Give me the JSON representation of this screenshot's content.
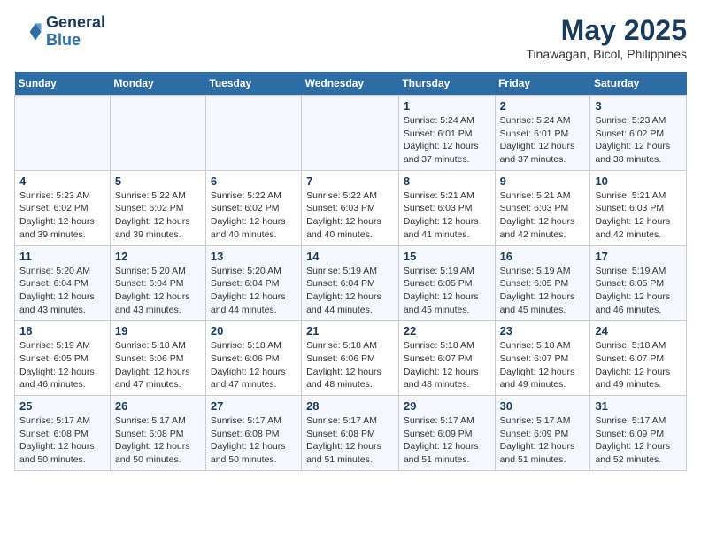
{
  "header": {
    "logo_line1": "General",
    "logo_line2": "Blue",
    "month": "May 2025",
    "location": "Tinawagan, Bicol, Philippines"
  },
  "days_of_week": [
    "Sunday",
    "Monday",
    "Tuesday",
    "Wednesday",
    "Thursday",
    "Friday",
    "Saturday"
  ],
  "weeks": [
    [
      {
        "day": "",
        "info": ""
      },
      {
        "day": "",
        "info": ""
      },
      {
        "day": "",
        "info": ""
      },
      {
        "day": "",
        "info": ""
      },
      {
        "day": "1",
        "info": "Sunrise: 5:24 AM\nSunset: 6:01 PM\nDaylight: 12 hours and 37 minutes."
      },
      {
        "day": "2",
        "info": "Sunrise: 5:24 AM\nSunset: 6:01 PM\nDaylight: 12 hours and 37 minutes."
      },
      {
        "day": "3",
        "info": "Sunrise: 5:23 AM\nSunset: 6:02 PM\nDaylight: 12 hours and 38 minutes."
      }
    ],
    [
      {
        "day": "4",
        "info": "Sunrise: 5:23 AM\nSunset: 6:02 PM\nDaylight: 12 hours and 39 minutes."
      },
      {
        "day": "5",
        "info": "Sunrise: 5:22 AM\nSunset: 6:02 PM\nDaylight: 12 hours and 39 minutes."
      },
      {
        "day": "6",
        "info": "Sunrise: 5:22 AM\nSunset: 6:02 PM\nDaylight: 12 hours and 40 minutes."
      },
      {
        "day": "7",
        "info": "Sunrise: 5:22 AM\nSunset: 6:03 PM\nDaylight: 12 hours and 40 minutes."
      },
      {
        "day": "8",
        "info": "Sunrise: 5:21 AM\nSunset: 6:03 PM\nDaylight: 12 hours and 41 minutes."
      },
      {
        "day": "9",
        "info": "Sunrise: 5:21 AM\nSunset: 6:03 PM\nDaylight: 12 hours and 42 minutes."
      },
      {
        "day": "10",
        "info": "Sunrise: 5:21 AM\nSunset: 6:03 PM\nDaylight: 12 hours and 42 minutes."
      }
    ],
    [
      {
        "day": "11",
        "info": "Sunrise: 5:20 AM\nSunset: 6:04 PM\nDaylight: 12 hours and 43 minutes."
      },
      {
        "day": "12",
        "info": "Sunrise: 5:20 AM\nSunset: 6:04 PM\nDaylight: 12 hours and 43 minutes."
      },
      {
        "day": "13",
        "info": "Sunrise: 5:20 AM\nSunset: 6:04 PM\nDaylight: 12 hours and 44 minutes."
      },
      {
        "day": "14",
        "info": "Sunrise: 5:19 AM\nSunset: 6:04 PM\nDaylight: 12 hours and 44 minutes."
      },
      {
        "day": "15",
        "info": "Sunrise: 5:19 AM\nSunset: 6:05 PM\nDaylight: 12 hours and 45 minutes."
      },
      {
        "day": "16",
        "info": "Sunrise: 5:19 AM\nSunset: 6:05 PM\nDaylight: 12 hours and 45 minutes."
      },
      {
        "day": "17",
        "info": "Sunrise: 5:19 AM\nSunset: 6:05 PM\nDaylight: 12 hours and 46 minutes."
      }
    ],
    [
      {
        "day": "18",
        "info": "Sunrise: 5:19 AM\nSunset: 6:05 PM\nDaylight: 12 hours and 46 minutes."
      },
      {
        "day": "19",
        "info": "Sunrise: 5:18 AM\nSunset: 6:06 PM\nDaylight: 12 hours and 47 minutes."
      },
      {
        "day": "20",
        "info": "Sunrise: 5:18 AM\nSunset: 6:06 PM\nDaylight: 12 hours and 47 minutes."
      },
      {
        "day": "21",
        "info": "Sunrise: 5:18 AM\nSunset: 6:06 PM\nDaylight: 12 hours and 48 minutes."
      },
      {
        "day": "22",
        "info": "Sunrise: 5:18 AM\nSunset: 6:07 PM\nDaylight: 12 hours and 48 minutes."
      },
      {
        "day": "23",
        "info": "Sunrise: 5:18 AM\nSunset: 6:07 PM\nDaylight: 12 hours and 49 minutes."
      },
      {
        "day": "24",
        "info": "Sunrise: 5:18 AM\nSunset: 6:07 PM\nDaylight: 12 hours and 49 minutes."
      }
    ],
    [
      {
        "day": "25",
        "info": "Sunrise: 5:17 AM\nSunset: 6:08 PM\nDaylight: 12 hours and 50 minutes."
      },
      {
        "day": "26",
        "info": "Sunrise: 5:17 AM\nSunset: 6:08 PM\nDaylight: 12 hours and 50 minutes."
      },
      {
        "day": "27",
        "info": "Sunrise: 5:17 AM\nSunset: 6:08 PM\nDaylight: 12 hours and 50 minutes."
      },
      {
        "day": "28",
        "info": "Sunrise: 5:17 AM\nSunset: 6:08 PM\nDaylight: 12 hours and 51 minutes."
      },
      {
        "day": "29",
        "info": "Sunrise: 5:17 AM\nSunset: 6:09 PM\nDaylight: 12 hours and 51 minutes."
      },
      {
        "day": "30",
        "info": "Sunrise: 5:17 AM\nSunset: 6:09 PM\nDaylight: 12 hours and 51 minutes."
      },
      {
        "day": "31",
        "info": "Sunrise: 5:17 AM\nSunset: 6:09 PM\nDaylight: 12 hours and 52 minutes."
      }
    ]
  ]
}
